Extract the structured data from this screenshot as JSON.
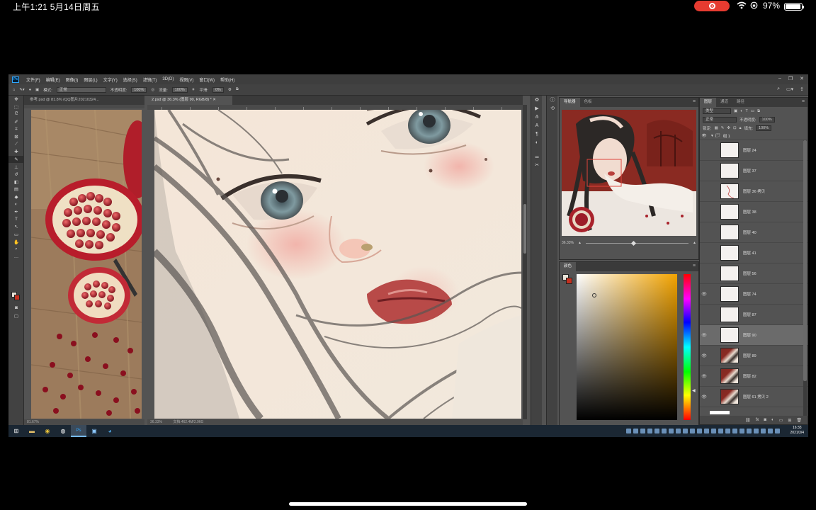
{
  "ios_status": {
    "time_date": "上午1:21   5月14日周五",
    "battery": "97%"
  },
  "app": {
    "logo": "Ps",
    "menu": [
      "文件(F)",
      "编辑(E)",
      "图像(I)",
      "图层(L)",
      "文字(Y)",
      "选择(S)",
      "滤镜(T)",
      "3D(D)",
      "视图(V)",
      "窗口(W)",
      "帮助(H)"
    ],
    "options": {
      "mode_label": "模式:",
      "mode_value": "正常",
      "opacity_label": "不透明度:",
      "opacity_value": "100%",
      "flow_label": "流量:",
      "flow_value": "100%",
      "smooth_label": "平滑:",
      "smooth_value": "0%"
    }
  },
  "documents": [
    {
      "tab": "参考.psd @ 81.8% (QQ图片20210324...",
      "status": "81.67%"
    },
    {
      "tab": "2.psd @ 36.3% (图层 90, RGB/8) *",
      "status_zoom": "36.33%",
      "status_doc": "文档:462.4M/2.96G"
    }
  ],
  "navigator": {
    "tabs": [
      "导航器",
      "色板"
    ],
    "zoom": "36.33%"
  },
  "color_panel": {
    "title": "颜色",
    "fg": "#e8e3d8",
    "bg": "#c5301f"
  },
  "layers_panel": {
    "tabs": [
      "图层",
      "通道",
      "路径"
    ],
    "kind": "类型",
    "blend": "正常",
    "opacity_label": "不透明度:",
    "opacity_value": "100%",
    "lock_label": "锁定:",
    "fill_label": "填充:",
    "fill_value": "100%",
    "group": "组 1",
    "layers": [
      {
        "name": "图层 24",
        "visible": false,
        "thumb": "blank"
      },
      {
        "name": "图层 37",
        "visible": false,
        "thumb": "blank"
      },
      {
        "name": "图层 36 拷贝",
        "visible": false,
        "thumb": "sketch"
      },
      {
        "name": "图层 38",
        "visible": false,
        "thumb": "blank"
      },
      {
        "name": "图层 40",
        "visible": false,
        "thumb": "blank"
      },
      {
        "name": "图层 41",
        "visible": false,
        "thumb": "blank"
      },
      {
        "name": "图层 56",
        "visible": false,
        "thumb": "blank"
      },
      {
        "name": "图层 74",
        "visible": true,
        "thumb": "blank"
      },
      {
        "name": "图层 87",
        "visible": false,
        "thumb": "blank"
      },
      {
        "name": "图层 90",
        "visible": true,
        "thumb": "blank",
        "selected": true
      },
      {
        "name": "图层 89",
        "visible": true,
        "thumb": "painting"
      },
      {
        "name": "图层 82",
        "visible": true,
        "thumb": "painting"
      },
      {
        "name": "图层 61 拷贝 2",
        "visible": true,
        "thumb": "painting"
      }
    ]
  },
  "taskbar": {
    "clock_time": "16:33",
    "clock_date": "2021/3/4"
  }
}
